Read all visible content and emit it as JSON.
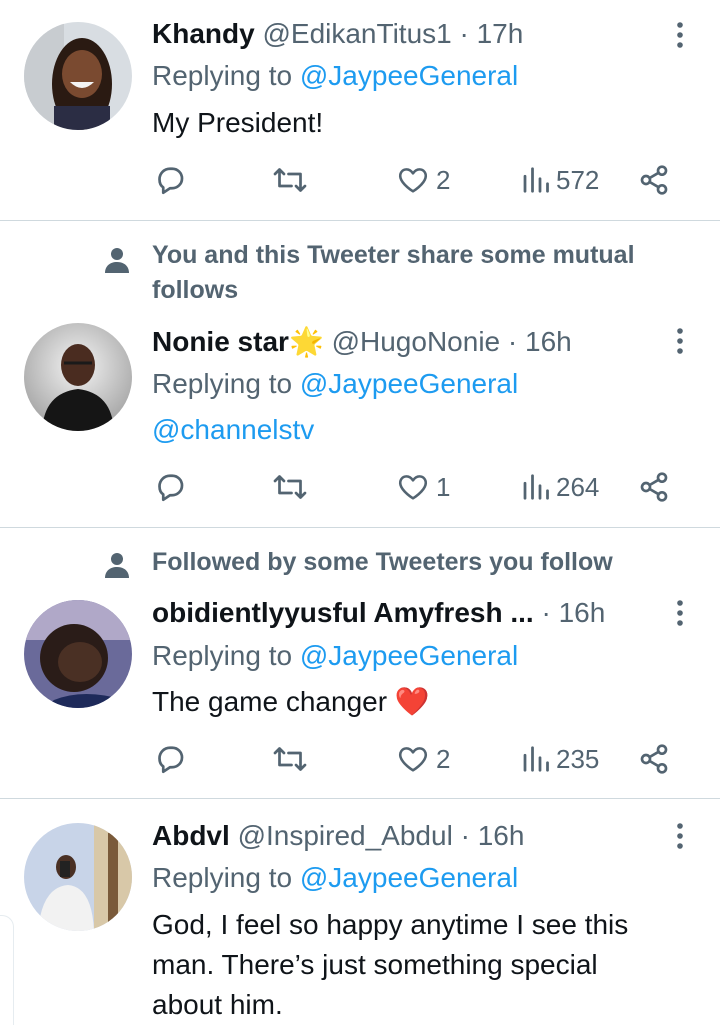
{
  "tweets": [
    {
      "name": "Khandy",
      "handle": "@EdikanTitus1",
      "separator": "·",
      "time": "17h",
      "replying_prefix": "Replying to ",
      "replying_to": "@JaypeeGeneral",
      "text": "My President!",
      "likes": "2",
      "views": "572"
    },
    {
      "social_context": "You and this Tweeter share some mutual follows",
      "name": "Nonie star",
      "name_emoji": "🌟",
      "handle": "@HugoNonie",
      "separator": "·",
      "time": "16h",
      "replying_prefix": "Replying to ",
      "replying_to": "@JaypeeGeneral",
      "text": "@channelstv",
      "likes": "1",
      "views": "264"
    },
    {
      "social_context": "Followed by some Tweeters you follow",
      "name": "obidientlyyusful Amyfresh ...",
      "separator": "·",
      "time": "16h",
      "replying_prefix": "Replying to ",
      "replying_to": "@JaypeeGeneral",
      "text": "The game changer",
      "text_emoji": "❤️",
      "likes": "2",
      "views": "235"
    },
    {
      "name": "Abdvl",
      "handle": "@Inspired_Abdul",
      "separator": "·",
      "time": "16h",
      "replying_prefix": "Replying to ",
      "replying_to": "@JaypeeGeneral",
      "text_lines": [
        "God, I feel so happy anytime I see this",
        "man. There’s just something special",
        "about him."
      ]
    }
  ],
  "colors": {
    "primary_text": "#0f1419",
    "secondary_text": "#536471",
    "accent": "#1d9bf0",
    "divider": "#cfd9de",
    "heart_emoji": "#dd2e44"
  },
  "icons": [
    "reply-icon",
    "retweet-icon",
    "like-icon",
    "views-icon",
    "share-icon",
    "more-icon",
    "person-icon"
  ]
}
